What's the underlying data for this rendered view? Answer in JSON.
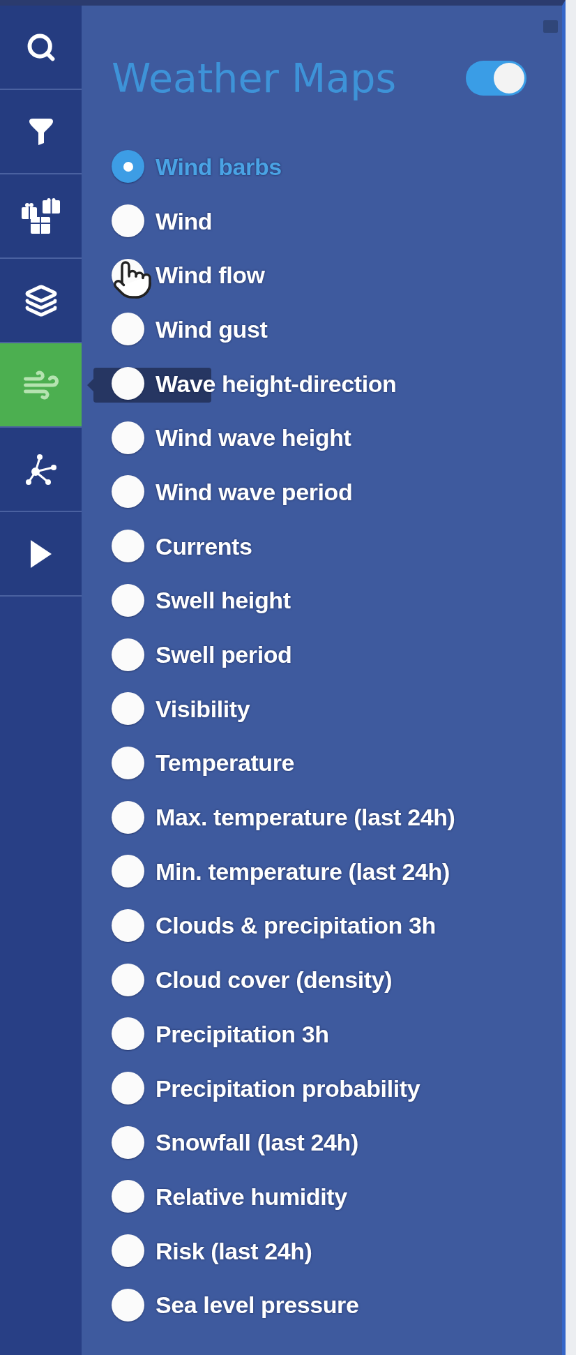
{
  "sidebar": {
    "items": [
      {
        "kind": "search",
        "selected": false,
        "tooltip_open": false
      },
      {
        "kind": "filter",
        "selected": false,
        "tooltip_open": false
      },
      {
        "kind": "gifts",
        "selected": false,
        "tooltip_open": false
      },
      {
        "kind": "layers",
        "selected": false,
        "tooltip_open": false
      },
      {
        "kind": "wind",
        "selected": true,
        "tooltip_open": true
      },
      {
        "kind": "network",
        "selected": false,
        "tooltip_open": false
      },
      {
        "kind": "play",
        "selected": false,
        "tooltip_open": false
      }
    ]
  },
  "panel": {
    "title": "Weather Maps",
    "toggle": {
      "on": true
    },
    "options": [
      {
        "label": "Wind barbs",
        "selected": true,
        "hovered": false
      },
      {
        "label": "Wind",
        "selected": false,
        "hovered": false
      },
      {
        "label": "Wind flow",
        "selected": false,
        "hovered": true
      },
      {
        "label": "Wind gust",
        "selected": false,
        "hovered": false
      },
      {
        "label": "Wave height-direction",
        "selected": false,
        "hovered": false
      },
      {
        "label": "Wind wave height",
        "selected": false,
        "hovered": false
      },
      {
        "label": "Wind wave period",
        "selected": false,
        "hovered": false
      },
      {
        "label": "Currents",
        "selected": false,
        "hovered": false
      },
      {
        "label": "Swell height",
        "selected": false,
        "hovered": false
      },
      {
        "label": "Swell period",
        "selected": false,
        "hovered": false
      },
      {
        "label": "Visibility",
        "selected": false,
        "hovered": false
      },
      {
        "label": "Temperature",
        "selected": false,
        "hovered": false
      },
      {
        "label": "Max. temperature (last 24h)",
        "selected": false,
        "hovered": false
      },
      {
        "label": "Min. temperature (last 24h)",
        "selected": false,
        "hovered": false
      },
      {
        "label": "Clouds & precipitation 3h",
        "selected": false,
        "hovered": false
      },
      {
        "label": "Cloud cover (density)",
        "selected": false,
        "hovered": false
      },
      {
        "label": "Precipitation 3h",
        "selected": false,
        "hovered": false
      },
      {
        "label": "Precipitation probability",
        "selected": false,
        "hovered": false
      },
      {
        "label": "Snowfall (last 24h)",
        "selected": false,
        "hovered": false
      },
      {
        "label": "Relative humidity",
        "selected": false,
        "hovered": false
      },
      {
        "label": "Risk (last 24h)",
        "selected": false,
        "hovered": false
      },
      {
        "label": "Sea level pressure",
        "selected": false,
        "hovered": false
      }
    ]
  }
}
